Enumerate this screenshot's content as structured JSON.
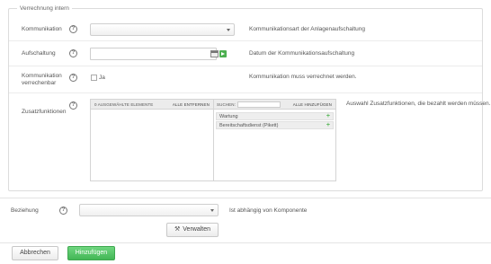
{
  "fieldset": {
    "legend": "Verrechnung intern"
  },
  "fields": {
    "kommunikation": {
      "label": "Kommunikation",
      "help": "?",
      "description": "Kommunikationsart der Anlagenaufschaltung"
    },
    "aufschaltung": {
      "label": "Aufschaltung",
      "help": "?",
      "description": "Datum der Kommunikationsaufschaltung"
    },
    "verrechenbar": {
      "label_line1": "Kommunikation",
      "label_line2": "verrechenbar",
      "help": "?",
      "checkbox_label": "Ja",
      "description": "Kommunikation muss verrechnet werden."
    },
    "zusatzfunktionen": {
      "label": "Zusatzfunktionen",
      "help": "?",
      "description": "Auswahl Zusatzfunktionen, die bezahlt werden müssen.",
      "selected_header": "0 ausgewählte Elemente",
      "remove_all": "Alle entfernen",
      "search_label": "Suchen:",
      "add_all": "Alle hinzufügen",
      "available": [
        {
          "label": "Wartung",
          "action": "+"
        },
        {
          "label": "Bereitschaftsdienst (Pikett)",
          "action": "+"
        }
      ]
    }
  },
  "beziehung": {
    "label": "Beziehung",
    "help": "?",
    "description": "Ist abhängig von Komponente",
    "manage_button": "Verwalten",
    "manage_icon": "wrench-icon"
  },
  "footer": {
    "cancel": "Abbrechen",
    "add": "Hinzufügen"
  },
  "colors": {
    "accent_green": "#43b655",
    "plus_green": "#5cb85c"
  }
}
